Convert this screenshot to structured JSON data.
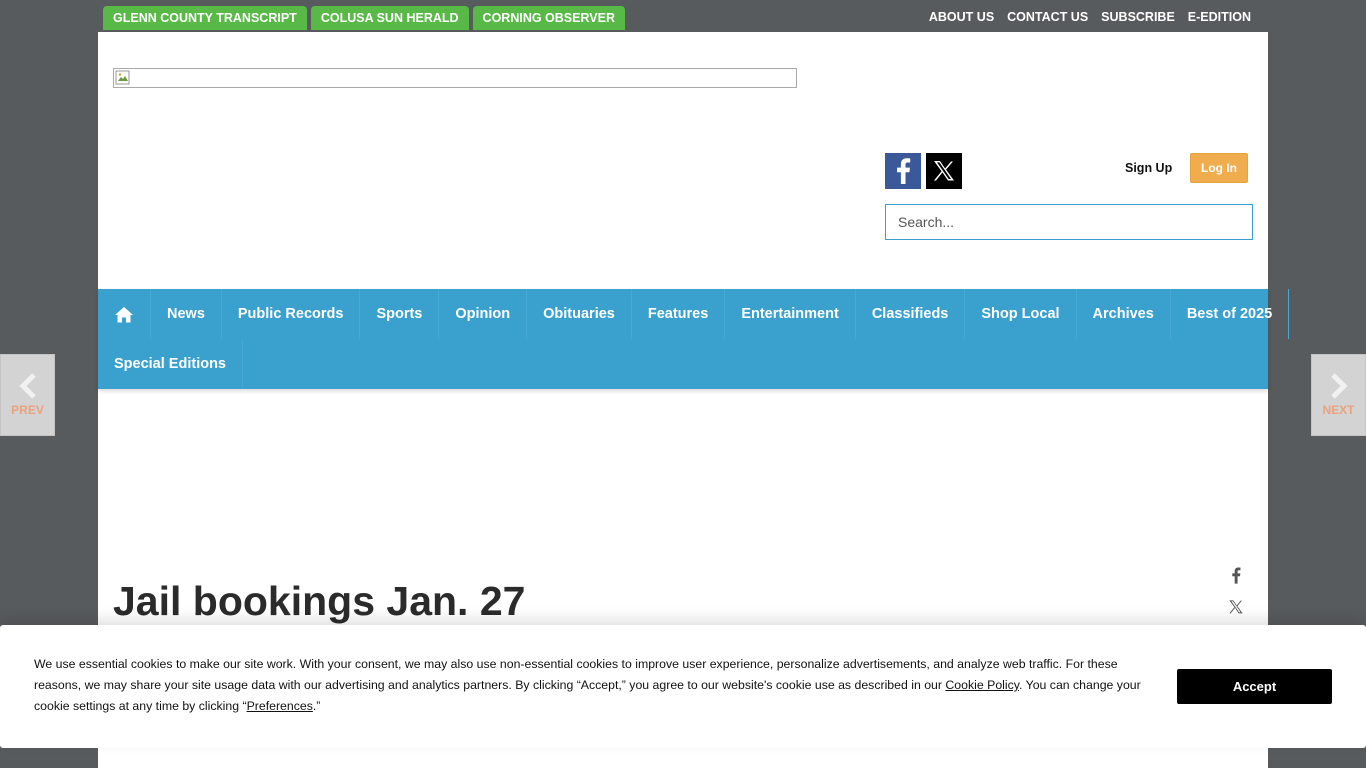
{
  "sister_sites": [
    {
      "label": "GLENN COUNTY TRANSCRIPT"
    },
    {
      "label": "COLUSA SUN HERALD"
    },
    {
      "label": "CORNING OBSERVER"
    }
  ],
  "top_links": [
    {
      "label": "ABOUT US"
    },
    {
      "label": "CONTACT US"
    },
    {
      "label": "SUBSCRIBE"
    },
    {
      "label": "E-EDITION"
    }
  ],
  "account": {
    "signup_label": "Sign Up",
    "login_label": "Log In"
  },
  "search": {
    "placeholder": "Search..."
  },
  "nav": {
    "row1": [
      {
        "label": "News"
      },
      {
        "label": "Public Records"
      },
      {
        "label": "Sports"
      },
      {
        "label": "Opinion"
      },
      {
        "label": "Obituaries"
      },
      {
        "label": "Features"
      },
      {
        "label": "Entertainment"
      },
      {
        "label": "Classifieds"
      },
      {
        "label": "Shop Local"
      },
      {
        "label": "Archives"
      },
      {
        "label": "Best of 2025"
      }
    ],
    "row2": [
      {
        "label": "Special Editions"
      }
    ]
  },
  "article": {
    "title": "Jail bookings Jan. 27"
  },
  "side_nav": {
    "prev_label": "PREV",
    "next_label": "NEXT"
  },
  "cookie": {
    "text_part1": "We use essential cookies to make our site work. With your consent, we may also use non-essential cookies to improve user experience, personalize advertisements, and analyze web traffic. For these reasons, we may share your site usage data with our advertising and analytics partners. By clicking “Accept,” you agree to our website's cookie use as described in our ",
    "policy_link": "Cookie Policy",
    "text_part2": ". You can change your cookie settings at any time by clicking “",
    "preferences_link": "Preferences",
    "text_part3": ".”",
    "accept_label": "Accept"
  },
  "colors": {
    "sister_tab_green": "#58b947",
    "nav_blue": "#3aa1cf",
    "login_orange": "#f0ad4e",
    "facebook_blue": "#3b5998",
    "background_gray": "#585b5e"
  },
  "icons": [
    "home-icon",
    "facebook-icon",
    "x-icon",
    "chevron-left-icon",
    "chevron-right-icon",
    "broken-image-icon"
  ]
}
